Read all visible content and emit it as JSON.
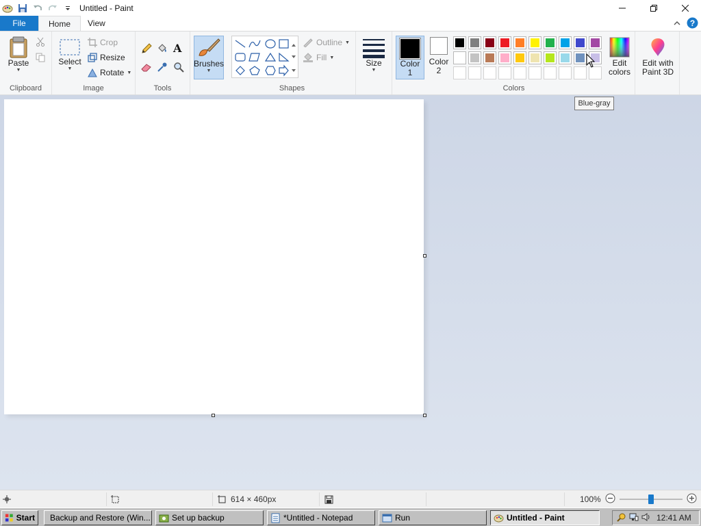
{
  "window": {
    "title": "Untitled - Paint"
  },
  "tabs": [
    {
      "label": "File"
    },
    {
      "label": "Home"
    },
    {
      "label": "View"
    }
  ],
  "clipboard": {
    "paste_label": "Paste",
    "group_label": "Clipboard"
  },
  "image": {
    "select_label": "Select",
    "crop_label": "Crop",
    "resize_label": "Resize",
    "rotate_label": "Rotate",
    "group_label": "Image"
  },
  "tools": {
    "group_label": "Tools"
  },
  "brushes": {
    "label": "Brushes"
  },
  "shapes": {
    "outline_label": "Outline",
    "fill_label": "Fill",
    "group_label": "Shapes"
  },
  "size": {
    "label": "Size"
  },
  "colors": {
    "color1_label": "Color\n1",
    "color1_value": "#000000",
    "color2_label": "Color\n2",
    "color2_value": "#ffffff",
    "group_label": "Colors",
    "palette_row1": [
      "#000000",
      "#7f7f7f",
      "#880015",
      "#ed1c24",
      "#ff7f27",
      "#fff200",
      "#22b14c",
      "#00a2e8",
      "#3f48cc",
      "#a349a4"
    ],
    "palette_row2": [
      "#ffffff",
      "#c3c3c3",
      "#b97a57",
      "#ffaec9",
      "#ffc90e",
      "#efe4b0",
      "#b5e61d",
      "#99d9ea",
      "#7092be",
      "#c8bfe7"
    ],
    "edit_colors_label": "Edit\ncolors",
    "edit_paint3d_label": "Edit with\nPaint 3D"
  },
  "tooltip": {
    "text": "Blue-gray"
  },
  "statusbar": {
    "dimensions": "614 × 460px",
    "zoom": "100%",
    "zoom_percent": 100
  },
  "taskbar": {
    "start_label": "Start",
    "items": [
      {
        "label": "Backup and Restore (Win..."
      },
      {
        "label": "Set up backup"
      },
      {
        "label": "*Untitled - Notepad"
      },
      {
        "label": "Run"
      },
      {
        "label": "Untitled - Paint"
      }
    ],
    "clock": "12:41 AM"
  }
}
